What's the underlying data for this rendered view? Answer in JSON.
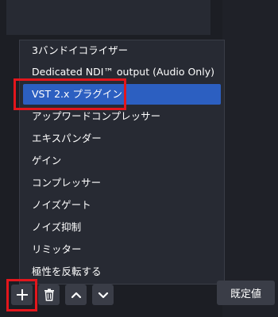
{
  "menu": {
    "items": [
      {
        "label": "3バンドイコライザー"
      },
      {
        "label": "Dedicated NDI™ output (Audio Only)"
      },
      {
        "label": "VST 2.x プラグイン",
        "selected": true
      },
      {
        "label": "アップワードコンプレッサー"
      },
      {
        "label": "エキスパンダー"
      },
      {
        "label": "ゲイン"
      },
      {
        "label": "コンプレッサー"
      },
      {
        "label": "ノイズゲート"
      },
      {
        "label": "ノイズ抑制"
      },
      {
        "label": "リミッター"
      },
      {
        "label": "極性を反転する"
      }
    ]
  },
  "toolbar": {
    "add_icon": "plus-icon",
    "remove_icon": "trash-icon",
    "up_icon": "chevron-up-icon",
    "down_icon": "chevron-down-icon",
    "default_label": "既定値"
  },
  "colors": {
    "selection": "#2c5fc1",
    "highlight_box": "#e3161c",
    "menu_bg": "#272a33"
  }
}
